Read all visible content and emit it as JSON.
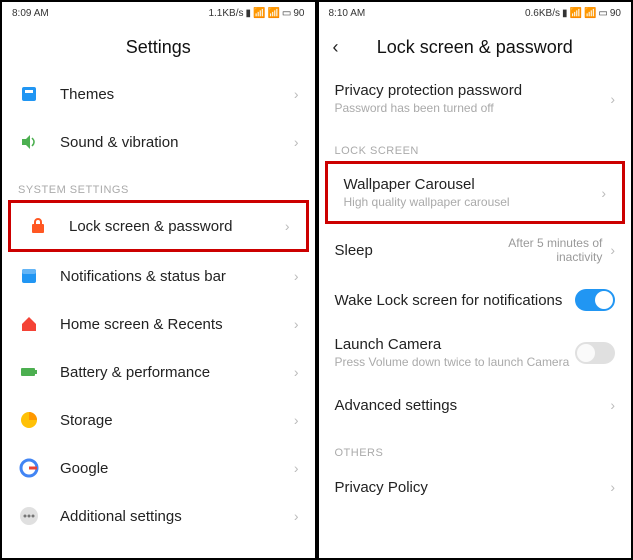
{
  "left": {
    "status": {
      "time": "8:09 AM",
      "net": "1.1KB/s",
      "battery": "90"
    },
    "header": {
      "title": "Settings"
    },
    "rows": [
      {
        "label": "Themes",
        "icon": "themes"
      },
      {
        "label": "Sound & vibration",
        "icon": "sound"
      }
    ],
    "section1": "SYSTEM SETTINGS",
    "system_rows": [
      {
        "label": "Lock screen & password",
        "icon": "lock",
        "highlight": true
      },
      {
        "label": "Notifications & status bar",
        "icon": "notif"
      },
      {
        "label": "Home screen & Recents",
        "icon": "home"
      },
      {
        "label": "Battery & performance",
        "icon": "battery"
      },
      {
        "label": "Storage",
        "icon": "storage"
      },
      {
        "label": "Google",
        "icon": "google"
      },
      {
        "label": "Additional settings",
        "icon": "more"
      }
    ]
  },
  "right": {
    "status": {
      "time": "8:10 AM",
      "net": "0.6KB/s",
      "battery": "90"
    },
    "header": {
      "title": "Lock screen & password"
    },
    "top_rows": [
      {
        "label": "Privacy protection password",
        "sub": "Password has been turned off"
      }
    ],
    "section1": "LOCK SCREEN",
    "lock_rows": [
      {
        "label": "Wallpaper Carousel",
        "sub": "High quality wallpaper carousel",
        "highlight": true,
        "chev": true
      },
      {
        "label": "Sleep",
        "value": "After 5 minutes of inactivity",
        "chev": true
      },
      {
        "label": "Wake Lock screen for notifications",
        "toggle": "on"
      },
      {
        "label": "Launch Camera",
        "sub": "Press Volume down twice to launch Camera",
        "toggle": "off"
      },
      {
        "label": "Advanced settings",
        "chev": true
      }
    ],
    "section2": "OTHERS",
    "other_rows": [
      {
        "label": "Privacy Policy",
        "chev": true
      }
    ]
  }
}
